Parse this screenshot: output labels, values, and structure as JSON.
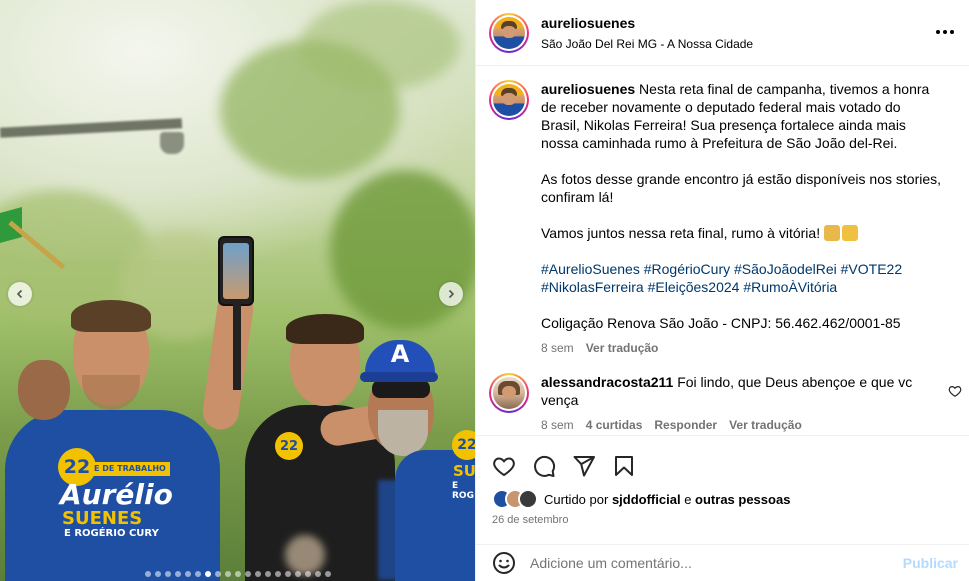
{
  "post": {
    "username": "aureliosuenes",
    "location": "São João Del Rei MG - A Nossa Cidade"
  },
  "caption": {
    "username": "aureliosuenes",
    "paragraph1": "Nesta reta final de campanha, tivemos a honra de receber novamente o deputado federal mais votado do Brasil, Nikolas Ferreira! Sua presença fortalece ainda mais nossa caminhada rumo à Prefeitura de São João del-Rei.",
    "paragraph2": "As fotos desse grande encontro já estão disponíveis nos stories, confiram lá!",
    "paragraph3": "Vamos juntos nessa reta final, rumo à vitória!",
    "hashtags_line1": "#AurelioSuenes #RogérioCury #SãoJoãodelRei #VOTE22",
    "hashtags_line2": "#NikolasFerreira #Eleições2024 #RumoÀVitória",
    "coalition": "Coligação Renova São João - CNPJ: 56.462.462/0001-85",
    "time": "8 sem",
    "translate": "Ver tradução"
  },
  "comment": {
    "username": "alessandracosta211",
    "text": "Foi lindo, que Deus abençoe e que vc vença",
    "time": "8 sem",
    "likes": "4 curtidas",
    "reply": "Responder",
    "translate": "Ver tradução"
  },
  "likes": {
    "prefix": "Curtido por",
    "user": "sjddofficial",
    "connector": "e",
    "others": "outras pessoas"
  },
  "date": "26 de setembro",
  "add_comment": {
    "placeholder": "Adicione um comentário...",
    "publish": "Publicar"
  },
  "media": {
    "cap_letter": "A",
    "shirt_number": "22",
    "shirt_band": "E DE TRABALHO",
    "shirt_name_1": "Aurélio",
    "shirt_name_2": "SUENES",
    "shirt_name_3": "E ROGÉRIO CURY",
    "shirt_right_1": "SUE",
    "shirt_right_2": "E ROG",
    "carousel_total": 19,
    "carousel_active": 7
  },
  "colors": {
    "link": "#00376b",
    "muted": "#737373",
    "publish": "#b3dbff",
    "shirt_blue": "#1f4fa3",
    "campaign_yellow": "#f2c200"
  }
}
